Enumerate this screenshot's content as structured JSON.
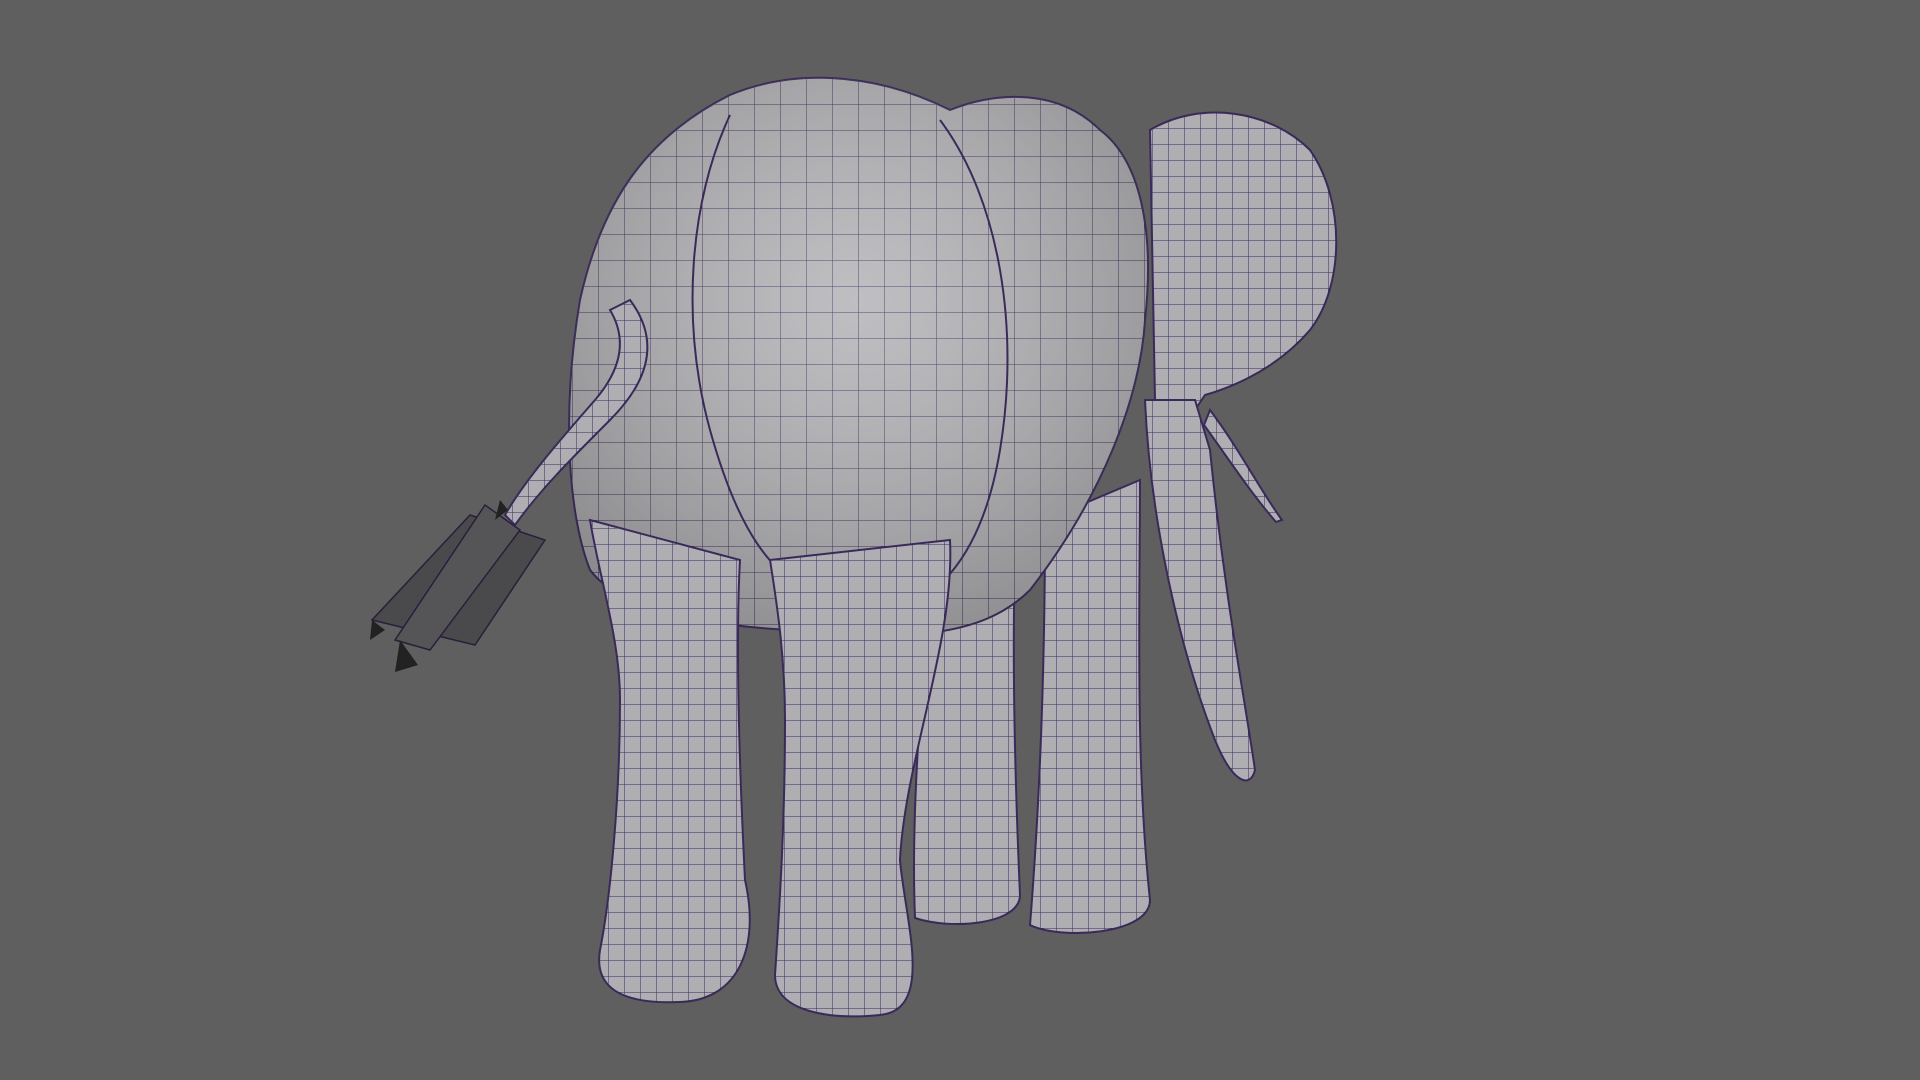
{
  "viewport": {
    "background_color": "#5f5f5f"
  },
  "model": {
    "subject": "elephant",
    "display_mode": "wireframe-on-shaded",
    "surface_color": "#b4b4b8",
    "wire_color": "#3a2a5a",
    "tail_tuft_color": "#4a4a4c"
  }
}
